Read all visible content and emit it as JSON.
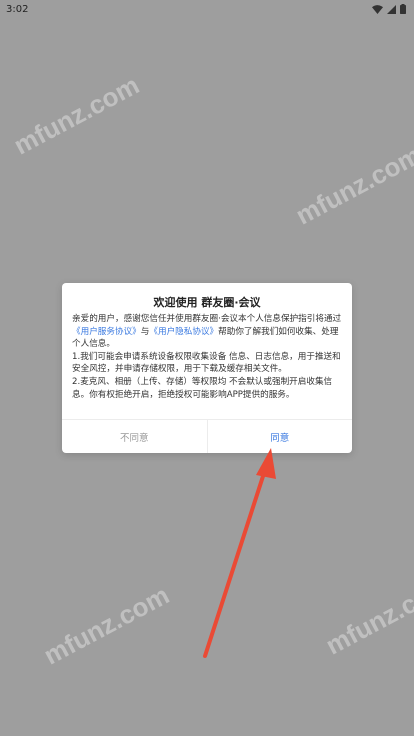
{
  "status_bar": {
    "time": "3:02"
  },
  "watermark": {
    "text": "mfunz.com"
  },
  "dialog": {
    "title": "欢迎使用 群友圈·会议",
    "para1_prefix": "亲爱的用户，感谢您信任并使用群友圈·会议本个人信息保护指引将通过",
    "link_service": "《用户服务协议》",
    "para1_mid": "与",
    "link_privacy": "《用户隐私协议》",
    "para1_suffix": "帮助你了解我们如何收集、处理个人信息。",
    "para2": "1.我们可能会申请系统设备权限收集设备 信息、日志信息，用于推送和安全风控，并申请存储权限，用于下载及缓存相关文件。",
    "para3": "2.麦克风、相册（上传、存储）等权限均 不会默认或强制开启收集信息。你有权拒绝开启，拒绝授权可能影响APP提供的服务。",
    "disagree_label": "不同意",
    "agree_label": "同意"
  },
  "colors": {
    "overlay": "#9e9e9e",
    "link": "#3b7ae0",
    "arrow": "#ea4a35"
  }
}
